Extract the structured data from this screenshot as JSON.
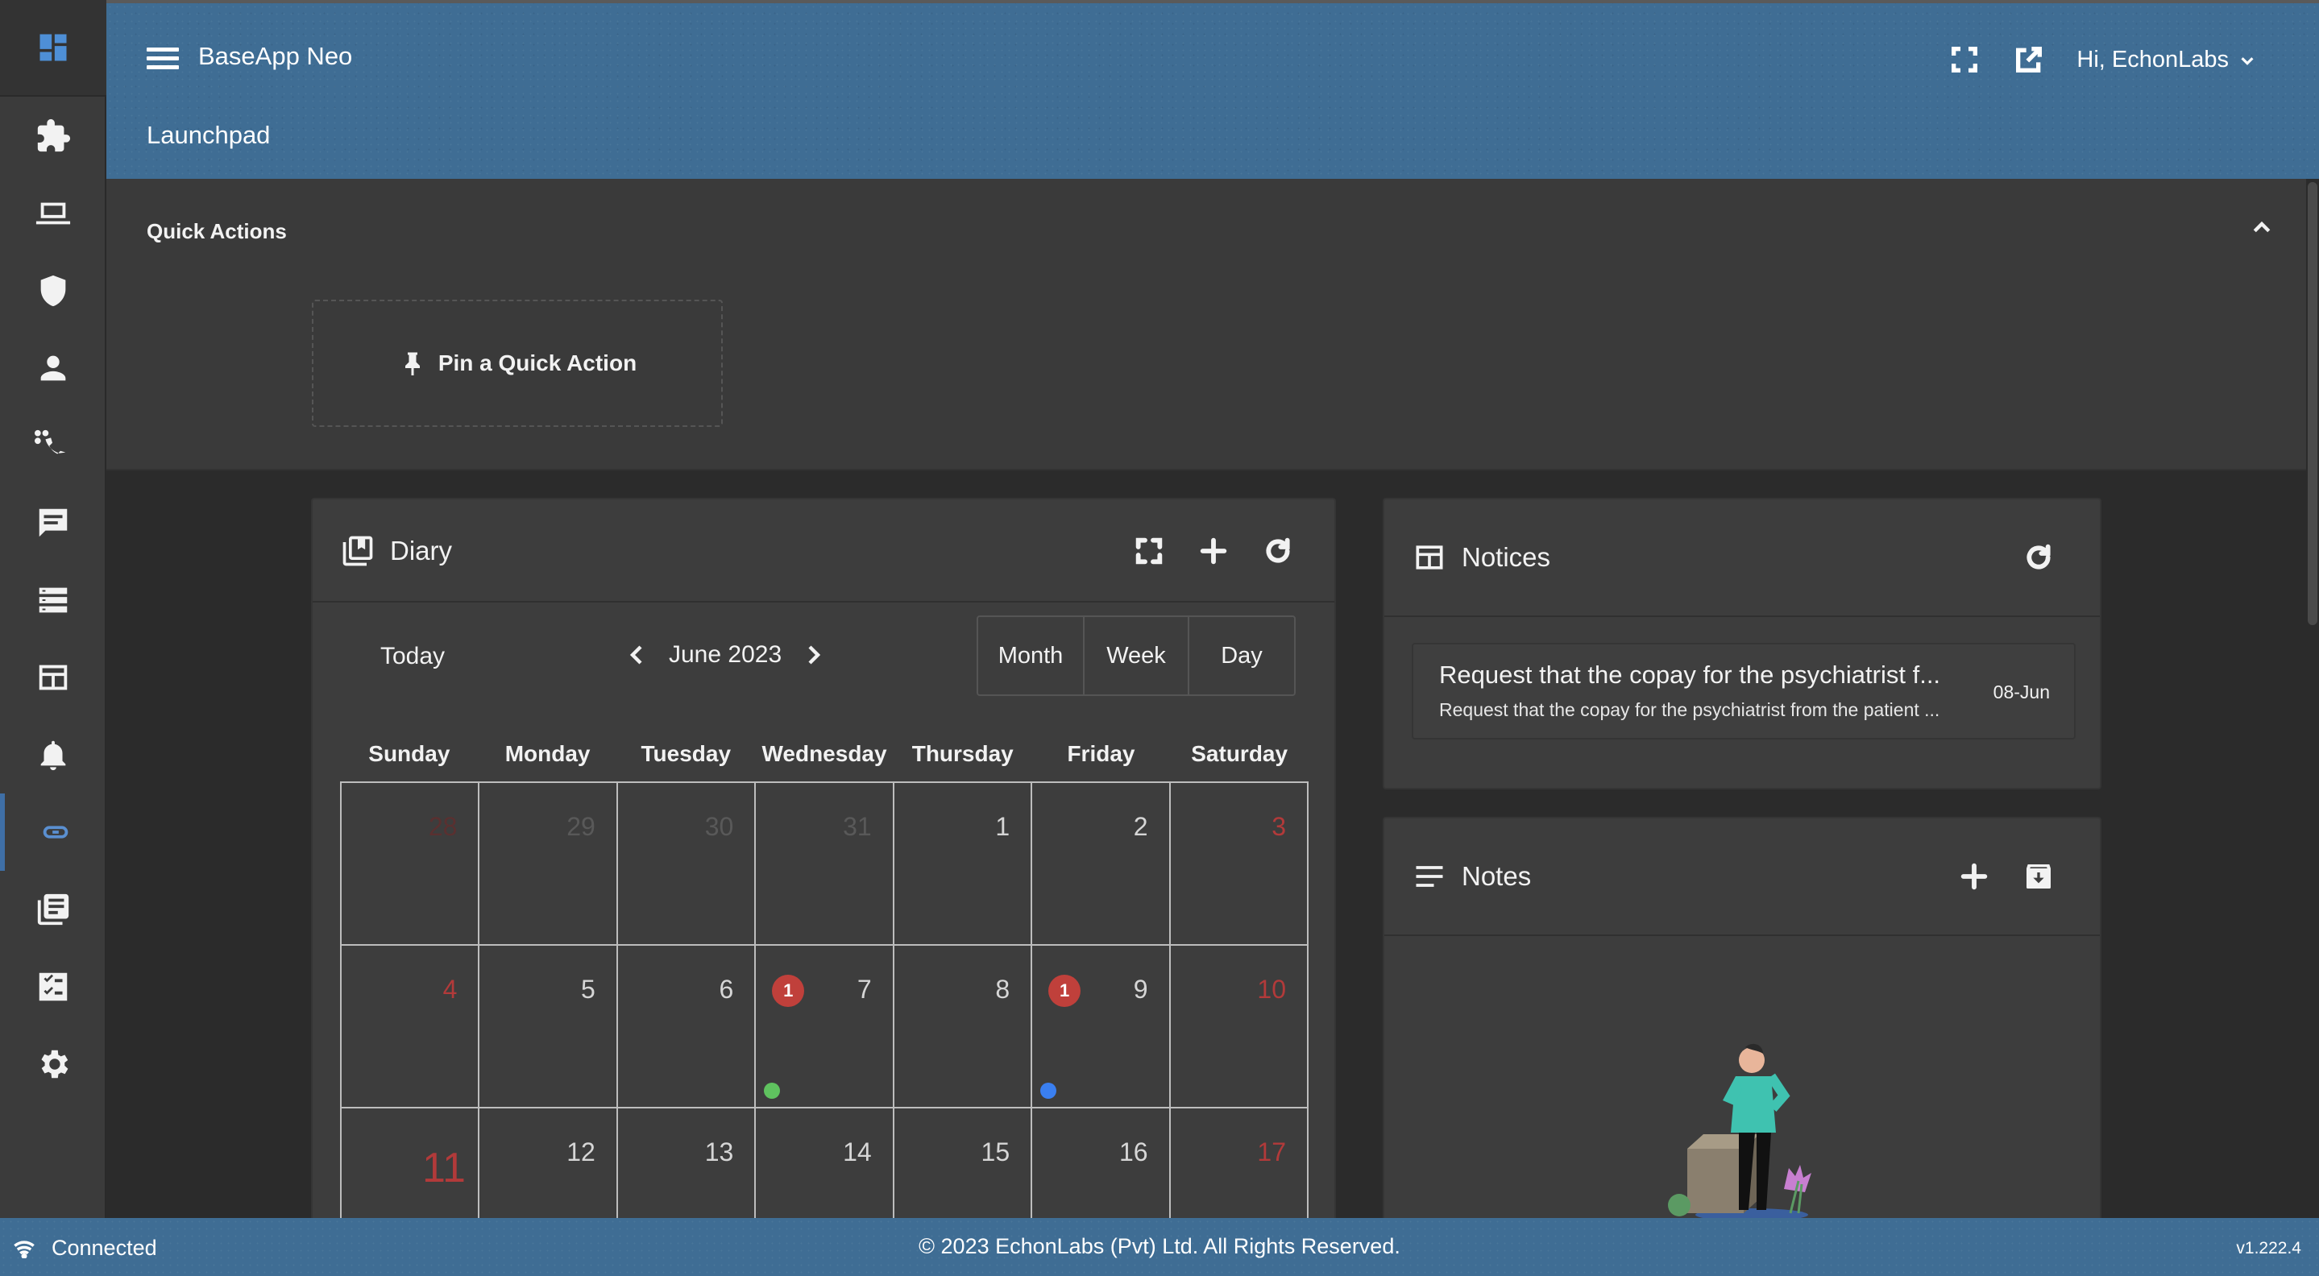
{
  "app": {
    "title": "BaseApp Neo",
    "page_title": "Launchpad",
    "user_greeting": "Hi, EchonLabs"
  },
  "sidebar": {
    "items": [
      {
        "name": "extensions-icon"
      },
      {
        "name": "laptop-icon"
      },
      {
        "name": "shield-icon"
      },
      {
        "name": "person-icon"
      },
      {
        "name": "dial-icon"
      },
      {
        "name": "chat-icon"
      },
      {
        "name": "list-icon"
      },
      {
        "name": "table-icon"
      },
      {
        "name": "bell-icon"
      },
      {
        "name": "link-icon",
        "active": true
      },
      {
        "name": "library-icon"
      },
      {
        "name": "checklist-icon"
      },
      {
        "name": "gear-icon"
      }
    ]
  },
  "quick_actions": {
    "title": "Quick Actions",
    "pin_label": "Pin a Quick Action"
  },
  "diary": {
    "title": "Diary",
    "today_label": "Today",
    "month_label": "June 2023",
    "views": [
      "Month",
      "Week",
      "Day"
    ],
    "weekdays": [
      "Sunday",
      "Monday",
      "Tuesday",
      "Wednesday",
      "Thursday",
      "Friday",
      "Saturday"
    ],
    "weeks": [
      [
        {
          "day": "28",
          "style": "red-muted"
        },
        {
          "day": "29",
          "style": "muted"
        },
        {
          "day": "30",
          "style": "muted"
        },
        {
          "day": "31",
          "style": "muted"
        },
        {
          "day": "1"
        },
        {
          "day": "2"
        },
        {
          "day": "3",
          "style": "red"
        }
      ],
      [
        {
          "day": "4",
          "style": "red"
        },
        {
          "day": "5"
        },
        {
          "day": "6"
        },
        {
          "day": "7",
          "badge": "1",
          "dot": "#5fc25f"
        },
        {
          "day": "8"
        },
        {
          "day": "9",
          "badge": "1",
          "dot": "#3a7ff0"
        },
        {
          "day": "10",
          "style": "red"
        }
      ],
      [
        {
          "day": "11",
          "style": "red big"
        },
        {
          "day": "12"
        },
        {
          "day": "13"
        },
        {
          "day": "14"
        },
        {
          "day": "15"
        },
        {
          "day": "16"
        },
        {
          "day": "17",
          "style": "red"
        }
      ]
    ]
  },
  "notices": {
    "title": "Notices",
    "items": [
      {
        "title": "Request that the copay for the psychiatrist f...",
        "subtitle": "Request that the copay for the psychiatrist from the patient ...",
        "date": "08-Jun"
      }
    ]
  },
  "notes": {
    "title": "Notes"
  },
  "footer": {
    "status": "Connected",
    "copyright": "© 2023 EchonLabs (Pvt) Ltd. All Rights Reserved.",
    "version": "v1.222.4"
  },
  "colors": {
    "header": "#3f6d94",
    "accent": "#5a8fd0",
    "weekend": "#b23a3a",
    "badge": "#c0403b"
  }
}
